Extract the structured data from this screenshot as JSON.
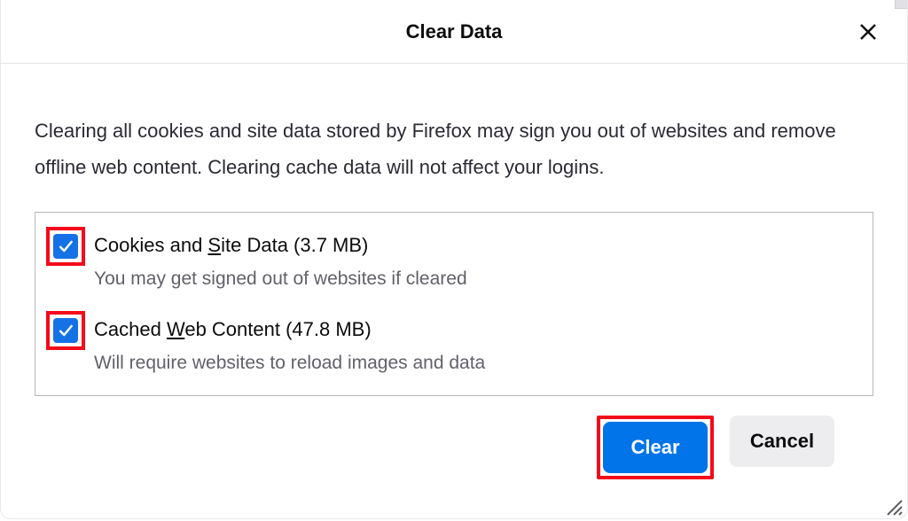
{
  "dialog": {
    "title": "Clear Data",
    "description": "Clearing all cookies and site data stored by Firefox may sign you out of websites and remove offline web content. Clearing cache data will not affect your logins."
  },
  "options": {
    "cookies": {
      "label_prefix": "Cookies and ",
      "label_underlined": "S",
      "label_suffix": "ite Data (3.7 MB)",
      "sub": "You may get signed out of websites if cleared",
      "checked": true
    },
    "cache": {
      "label_prefix": "Cached ",
      "label_underlined": "W",
      "label_suffix": "eb Content (47.8 MB)",
      "sub": "Will require websites to reload images and data",
      "checked": true
    }
  },
  "buttons": {
    "clear": "Clear",
    "cancel": "Cancel"
  }
}
